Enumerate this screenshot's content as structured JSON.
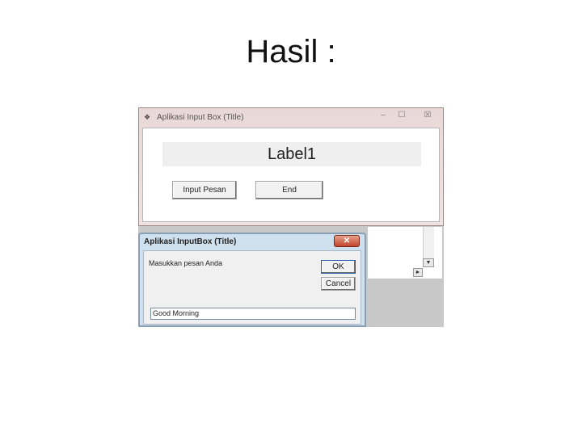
{
  "slide": {
    "title": "Hasil :"
  },
  "main_window": {
    "title": "Aplikasi Input Box (Title)",
    "controls": {
      "minimize": "‒",
      "maximize": "☐",
      "close": "☒"
    },
    "label": "Label1",
    "buttons": {
      "input_pesan": "Input Pesan",
      "end": "End"
    }
  },
  "input_dialog": {
    "title": "Aplikasi InputBox (Title)",
    "close": "✕",
    "prompt": "Masukkan pesan Anda",
    "ok_label": "OK",
    "cancel_label": "Cancel",
    "input_value": "Good Morning"
  },
  "background_scroll": {
    "down_arrow": "▼",
    "right_arrow": "►"
  }
}
